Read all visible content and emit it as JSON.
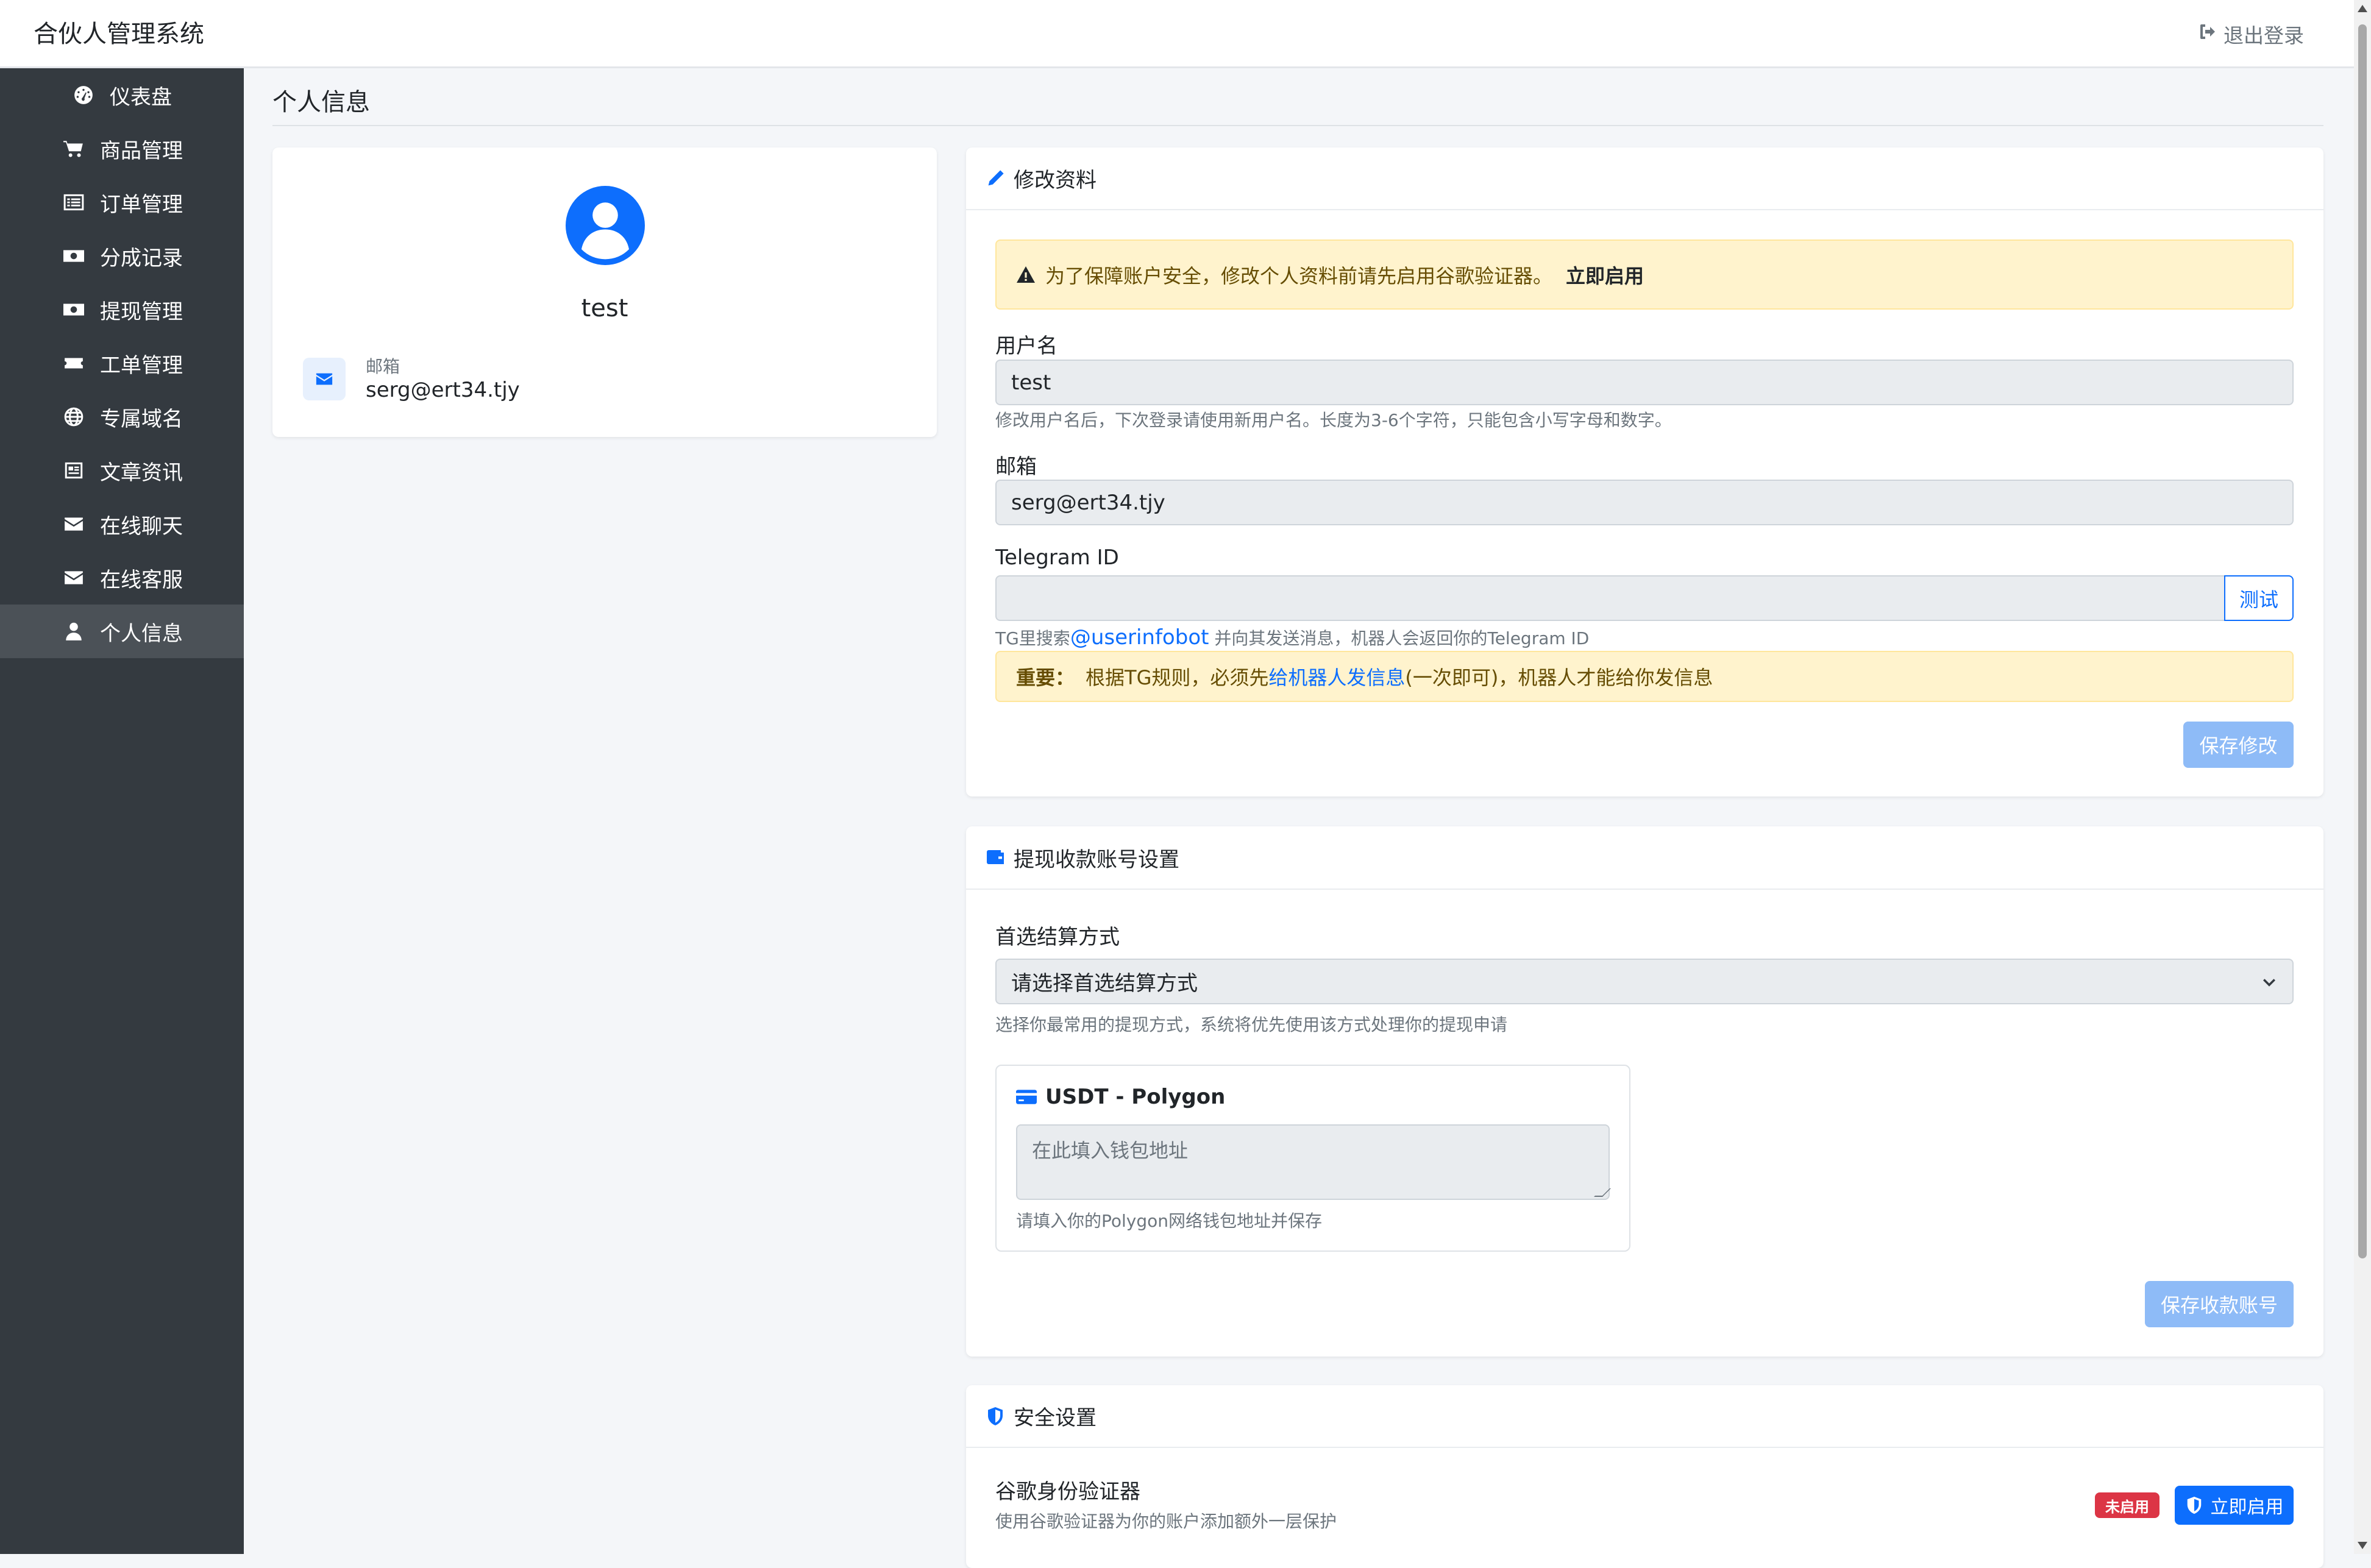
{
  "app": {
    "title": "合伙人管理系统",
    "logout_label": "退出登录"
  },
  "sidebar": {
    "items": [
      {
        "label": "仪表盘",
        "icon": "dashboard-icon"
      },
      {
        "label": "商品管理",
        "icon": "cart-icon"
      },
      {
        "label": "订单管理",
        "icon": "list-icon"
      },
      {
        "label": "分成记录",
        "icon": "money-icon"
      },
      {
        "label": "提现管理",
        "icon": "money-icon"
      },
      {
        "label": "工单管理",
        "icon": "ticket-icon"
      },
      {
        "label": "专属域名",
        "icon": "globe-icon"
      },
      {
        "label": "文章资讯",
        "icon": "newspaper-icon"
      },
      {
        "label": "在线聊天",
        "icon": "envelope-icon"
      },
      {
        "label": "在线客服",
        "icon": "envelope-icon"
      },
      {
        "label": "个人信息",
        "icon": "user-icon",
        "active": true
      }
    ]
  },
  "page": {
    "title": "个人信息"
  },
  "profile": {
    "name": "test",
    "email_label": "邮箱",
    "email": "serg@ert34.tjy"
  },
  "edit_profile": {
    "title": "修改资料",
    "warning_text": "为了保障账户安全，修改个人资料前请先启用谷歌验证器。",
    "warning_link": "立即启用",
    "username_label": "用户名",
    "username_value": "test",
    "username_hint": "修改用户名后，下次登录请使用新用户名。长度为3-6个字符，只能包含小写字母和数字。",
    "email_label": "邮箱",
    "email_value": "serg@ert34.tjy",
    "telegram_label": "Telegram ID",
    "telegram_value": "",
    "test_button": "测试",
    "tg_hint_prefix": "TG里搜索",
    "tg_hint_bot": "@userinfobot",
    "tg_hint_suffix": " 并向其发送消息，机器人会返回你的Telegram ID",
    "important_label": "重要：",
    "important_text_1": "根据TG规则，必须先",
    "important_link": "给机器人发信息",
    "important_text_2": "(一次即可)，机器人才能给你发信息",
    "save_button": "保存修改"
  },
  "withdraw": {
    "title": "提现收款账号设置",
    "method_label": "首选结算方式",
    "method_selected": "请选择首选结算方式",
    "method_hint": "选择你最常用的提现方式，系统将优先使用该方式处理你的提现申请",
    "usdt_title": "USDT - Polygon",
    "usdt_placeholder": "在此填入钱包地址",
    "usdt_hint": "请填入你的Polygon网络钱包地址并保存",
    "save_button": "保存收款账号"
  },
  "security": {
    "title": "安全设置",
    "ga_title": "谷歌身份验证器",
    "ga_desc": "使用谷歌验证器为你的账户添加额外一层保护",
    "status_badge": "未启用",
    "enable_button": "立即启用"
  },
  "colors": {
    "primary": "#0d6efd",
    "sidebar": "#343a40",
    "danger": "#dc3545",
    "warning_bg": "#fff3cd"
  }
}
